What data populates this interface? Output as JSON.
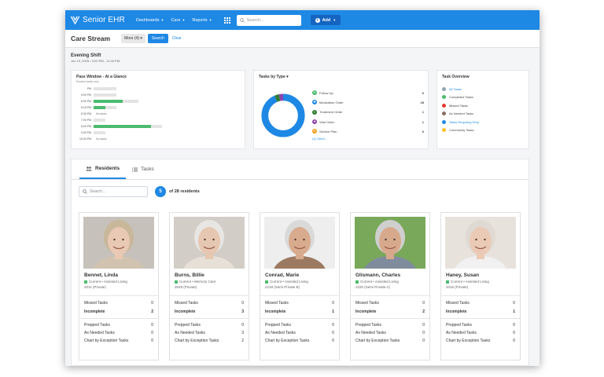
{
  "app": {
    "brand": "Senior EHR",
    "nav": [
      "Dashboards",
      "Care",
      "Reports"
    ],
    "search_placeholder": "Search...",
    "add_label": "Add"
  },
  "subheader": {
    "title": "Care Stream",
    "more_label": "More (4)",
    "search_label": "Search",
    "clear_label": "Clear"
  },
  "shift": {
    "title": "Evening Shift",
    "date": "Jun 19, 2025 • 3:00 PM - 11:00 PM"
  },
  "pass_window": {
    "title": "Pass Window - At a Glance",
    "subtitle": "Routine tasks only",
    "rows": [
      {
        "time": "PM",
        "total": 0.46,
        "done": 0,
        "no_tasks": false
      },
      {
        "time": "5:00 PM",
        "total": 0.46,
        "done": 0,
        "no_tasks": false
      },
      {
        "time": "6:00 PM",
        "total": 0.92,
        "done": 0.6,
        "no_tasks": false
      },
      {
        "time": "5:18 PM",
        "total": 0.46,
        "done": 0.24,
        "no_tasks": false
      },
      {
        "time": "6:30 PM",
        "total": 0,
        "done": 0,
        "no_tasks": true
      },
      {
        "time": "7:00 PM",
        "total": 0.24,
        "done": 0,
        "no_tasks": false
      },
      {
        "time": "8:00 PM",
        "total": 1.4,
        "done": 1.18,
        "no_tasks": false
      },
      {
        "time": "9:00 PM",
        "total": 0.24,
        "done": 0,
        "no_tasks": false
      },
      {
        "time": "10:00 PM",
        "total": 0,
        "done": 0,
        "no_tasks": true
      }
    ],
    "no_tasks_label": "No tasks"
  },
  "tasks_by_type": {
    "title": "Tasks by Type",
    "items": [
      {
        "label": "Follow Up",
        "count": "0",
        "color": "#4cbb6e"
      },
      {
        "label": "Medication Order",
        "count": "28",
        "color": "#1e88e5"
      },
      {
        "label": "Treatment Order",
        "count": "1",
        "color": "#2e7d32"
      },
      {
        "label": "Vital Order",
        "count": "1",
        "color": "#8e44ad"
      },
      {
        "label": "Service Plan",
        "count": "0",
        "color": "#f39c12"
      }
    ],
    "all_others_label": "(4) Other..."
  },
  "task_overview": {
    "title": "Task Overview",
    "items": [
      {
        "label": "All Tasks",
        "color": "#90a4ae",
        "link": true
      },
      {
        "label": "Completed Tasks",
        "color": "#4cbb6e",
        "link": false
      },
      {
        "label": "Missed Tasks",
        "color": "#e53935",
        "link": false
      },
      {
        "label": "As Needed Tasks",
        "color": "#8d6e63",
        "link": false
      },
      {
        "label": "Tasks Requiring Prep",
        "color": "#1e88e5",
        "link": true
      },
      {
        "label": "Community Tasks",
        "color": "#fbc02d",
        "link": false
      }
    ]
  },
  "residents": {
    "tab_residents": "Residents",
    "tab_tasks": "Tasks",
    "search_placeholder": "Search...",
    "shown_count": "5",
    "total_label": "of 28 residents",
    "cards": [
      {
        "name": "Bennet, Linda",
        "status": "Current • Assisted Living",
        "room": "2011 (Private)",
        "missed": "0",
        "incomplete": "2",
        "prepped": "0",
        "as_needed": "0",
        "exception": "0"
      },
      {
        "name": "Burns, Billie",
        "status": "Current • Memory Care",
        "room": "3029 (Private)",
        "missed": "0",
        "incomplete": "3",
        "prepped": "0",
        "as_needed": "3",
        "exception": "2"
      },
      {
        "name": "Conrad, Marie",
        "status": "Current • Assisted Living",
        "room": "2218 (Semi Private B)",
        "missed": "0",
        "incomplete": "1",
        "prepped": "0",
        "as_needed": "0",
        "exception": "0"
      },
      {
        "name": "Glismann, Charles",
        "status": "Current • Assisted Living",
        "room": "2220 (Semi Private A)",
        "missed": "0",
        "incomplete": "2",
        "prepped": "0",
        "as_needed": "0",
        "exception": "0"
      },
      {
        "name": "Haney, Susan",
        "status": "Current • Assisted Living",
        "room": "2016 (Private)",
        "missed": "0",
        "incomplete": "1",
        "prepped": "0",
        "as_needed": "0",
        "exception": "0"
      }
    ],
    "labels": {
      "missed": "Missed Tasks",
      "incomplete": "Incomplete",
      "prepped": "Prepped Tasks",
      "as_needed": "As Needed Tasks",
      "exception": "Chart by Exception Tasks"
    }
  }
}
